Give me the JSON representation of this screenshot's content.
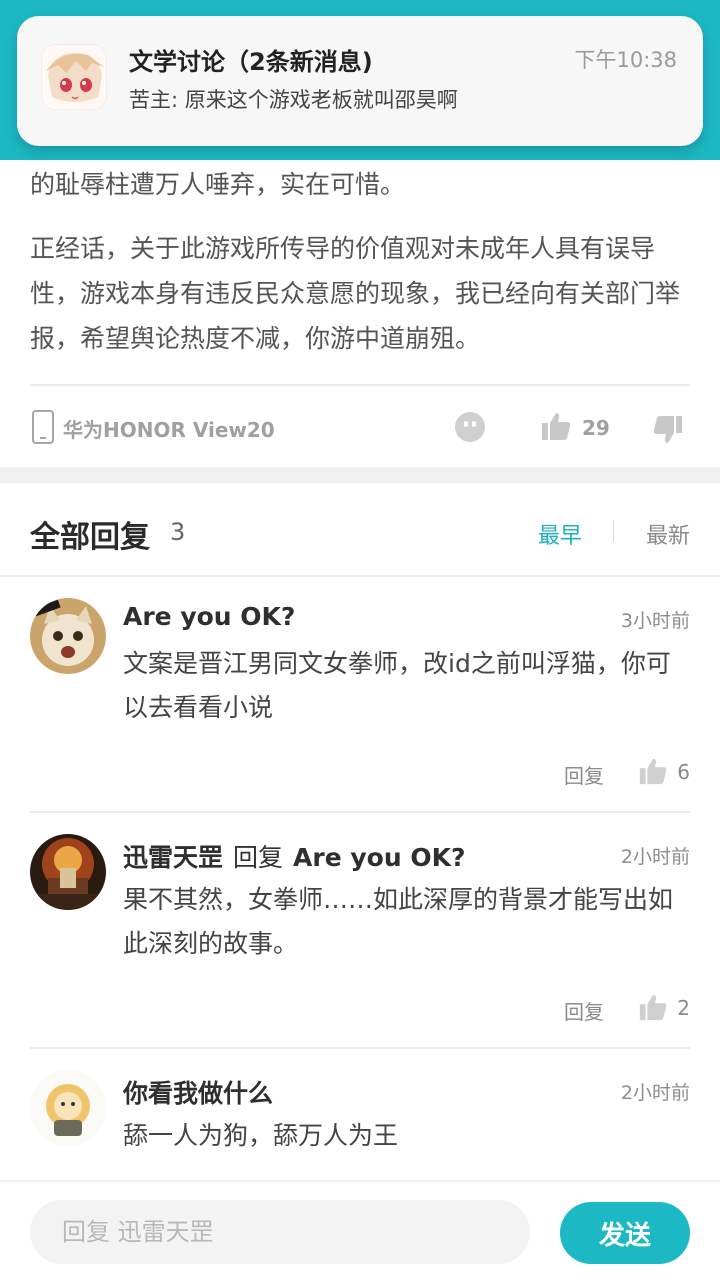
{
  "notification": {
    "title": "文学讨论（2条新消息)",
    "body": "苦主: 原来这个游戏老板就叫邵昊啊",
    "time": "下午10:38"
  },
  "post": {
    "paragraph1": "的耻辱柱遭万人唾弃，实在可惜。",
    "paragraph2": "正经话，关于此游戏所传导的价值观对未成年人具有误导性，游戏本身有违反民众意愿的现象，我已经向有关部门举报，希望舆论热度不减，你游中道崩殂。",
    "device": "华为HONOR View20",
    "like_count": "29",
    "icons": [
      "phone-icon",
      "emoji-icon",
      "thumbs-up-icon",
      "thumbs-down-icon"
    ]
  },
  "replies_header": {
    "title": "全部回复",
    "count": "3",
    "sort_earliest": "最早",
    "sort_newest": "最新",
    "accent_color": "#1cb1bd"
  },
  "comments": [
    {
      "author": "Are you OK?",
      "reply_to": "",
      "time": "3小时前",
      "text": "文案是晋江男同文女拳师，改id之前叫浮猫，你可以去看看小说",
      "reply_label": "回复",
      "likes": "6"
    },
    {
      "author": "迅雷天罡",
      "reply_word": "回复",
      "reply_to": "Are you OK?",
      "time": "2小时前",
      "text": "果不其然，女拳师……如此深厚的背景才能写出如此深刻的故事。",
      "reply_label": "回复",
      "likes": "2"
    },
    {
      "author": "你看我做什么",
      "reply_to": "",
      "time": "2小时前",
      "text": "舔一人为狗，舔万人为王"
    }
  ],
  "composer": {
    "placeholder": "回复 迅雷天罡",
    "send_label": "发送",
    "brand_color": "#1cb9c4"
  }
}
